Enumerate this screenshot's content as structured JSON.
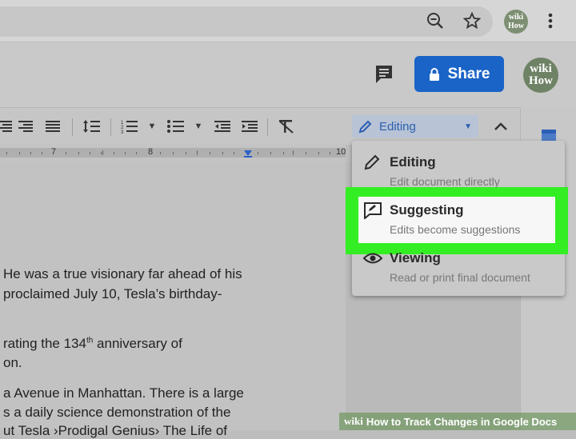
{
  "browser": {
    "icons": [
      "zoom-out-icon",
      "star-icon",
      "more-vert-icon"
    ],
    "avatar_text": "wiki How"
  },
  "header": {
    "share_label": "Share",
    "avatar_text": "wiki How"
  },
  "toolbar": {
    "mode_label": "Editing"
  },
  "ruler": {
    "ticks": [
      "7",
      "8",
      "10"
    ]
  },
  "menu": {
    "items": [
      {
        "title": "Editing",
        "desc": "Edit document directly",
        "icon": "pencil-icon"
      },
      {
        "title": "Suggesting",
        "desc": "Edits become suggestions",
        "icon": "suggest-icon"
      },
      {
        "title": "Viewing",
        "desc": "Read or print final document",
        "icon": "eye-icon"
      }
    ],
    "highlight_color": "#33ee22"
  },
  "document": {
    "lines": [
      "He was a true visionary far ahead of his",
      "proclaimed July 10, Tesla’s birthday-",
      "rating the 134",
      "th",
      " anniversary of",
      "on.",
      "a Avenue in Manhattan. There is a large",
      "s a daily science demonstration of the",
      "ut Tesla ›Prodigal Genius› The Life of"
    ]
  },
  "watermark": {
    "brand": "wiki",
    "text": "How to Track Changes in Google Docs"
  }
}
